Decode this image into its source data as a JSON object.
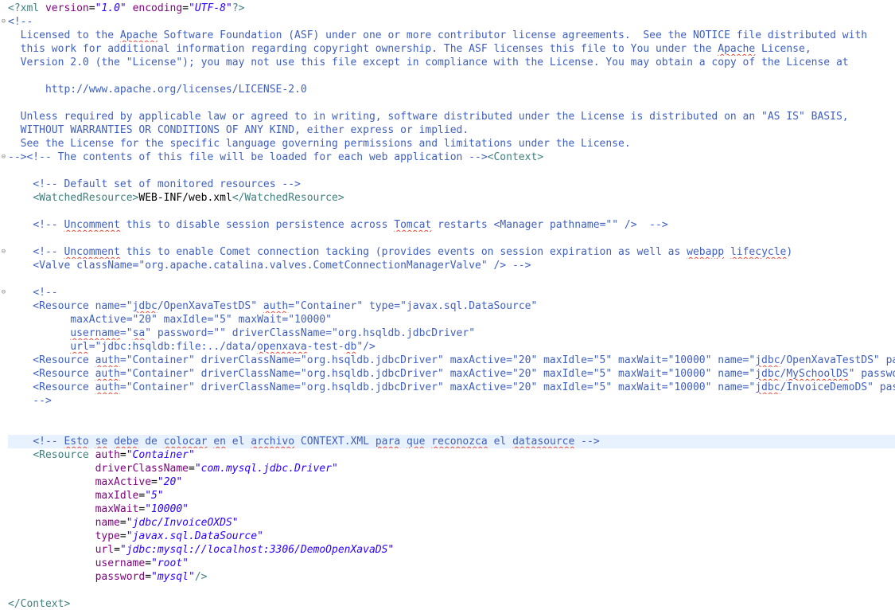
{
  "lines": [
    {
      "segs": [
        [
          "pi",
          "<?"
        ],
        [
          "tag",
          "xml "
        ],
        [
          "attr",
          "version"
        ],
        [
          "text",
          "="
        ],
        [
          "str",
          "\"1.0\""
        ],
        [
          "text",
          " "
        ],
        [
          "attr",
          "encoding"
        ],
        [
          "text",
          "="
        ],
        [
          "str",
          "\"UTF-8\""
        ],
        [
          "pi",
          "?>"
        ]
      ]
    },
    {
      "fold": true,
      "segs": [
        [
          "comment",
          "<!--"
        ]
      ]
    },
    {
      "segs": [
        [
          "comment",
          "  Licensed to the "
        ],
        [
          "comment",
          "Apache",
          "sq"
        ],
        [
          "comment",
          " Software Foundation (ASF) under one or more contributor license agreements.  See the NOTICE file distributed with"
        ]
      ]
    },
    {
      "segs": [
        [
          "comment",
          "  this work for additional information regarding copyright ownership. The ASF licenses this file to You under the "
        ],
        [
          "comment",
          "Apache",
          "sq"
        ],
        [
          "comment",
          " License,"
        ]
      ]
    },
    {
      "segs": [
        [
          "comment",
          "  Version 2.0 (the \"License\"); you may not use this file except in compliance with the License. You may obtain a copy of the License at"
        ]
      ]
    },
    {
      "segs": [
        [
          "comment",
          ""
        ]
      ]
    },
    {
      "segs": [
        [
          "comment",
          "      http://www.apache.org/licenses/LICENSE-2.0"
        ]
      ]
    },
    {
      "segs": [
        [
          "comment",
          ""
        ]
      ]
    },
    {
      "segs": [
        [
          "comment",
          "  Unless required by applicable law or agreed to in writing, software distributed under the License is distributed on an \"AS IS\" BASIS,"
        ]
      ]
    },
    {
      "segs": [
        [
          "comment",
          "  WITHOUT WARRANTIES OR CONDITIONS OF ANY KIND, either express or implied."
        ]
      ]
    },
    {
      "segs": [
        [
          "comment",
          "  See the License for the specific language governing permissions and limitations under the License."
        ]
      ]
    },
    {
      "fold": true,
      "segs": [
        [
          "comment",
          "--><!-- The contents of this file will be loaded for each web application -->"
        ],
        [
          "tag",
          "<Context>"
        ]
      ]
    },
    {
      "segs": [
        [
          "text",
          ""
        ]
      ]
    },
    {
      "segs": [
        [
          "text",
          "    "
        ],
        [
          "comment",
          "<!-- Default set of monitored resources -->"
        ]
      ]
    },
    {
      "segs": [
        [
          "text",
          "    "
        ],
        [
          "tag",
          "<WatchedResource>"
        ],
        [
          "text",
          "WEB-INF/web.xml"
        ],
        [
          "tag",
          "</WatchedResource>"
        ]
      ]
    },
    {
      "segs": [
        [
          "text",
          ""
        ]
      ]
    },
    {
      "segs": [
        [
          "text",
          "    "
        ],
        [
          "comment",
          "<!-- "
        ],
        [
          "comment",
          "Uncomment",
          "sq"
        ],
        [
          "comment",
          " this to disable session persistence across "
        ],
        [
          "comment",
          "Tomcat",
          "sq"
        ],
        [
          "comment",
          " restarts <Manager pathname=\"\" />  -->"
        ]
      ]
    },
    {
      "segs": [
        [
          "text",
          ""
        ]
      ]
    },
    {
      "fold": true,
      "segs": [
        [
          "text",
          "    "
        ],
        [
          "comment",
          "<!-- "
        ],
        [
          "comment",
          "Uncomment",
          "sq"
        ],
        [
          "comment",
          " this to enable Comet connection tacking (provides events on session expiration as well as "
        ],
        [
          "comment",
          "webapp",
          "sq"
        ],
        [
          "comment",
          " "
        ],
        [
          "comment",
          "lifecycle",
          "sq"
        ],
        [
          "comment",
          ")"
        ]
      ]
    },
    {
      "segs": [
        [
          "comment",
          "    <Valve className=\"org.apache.catalina.valves.CometConnectionManagerValve\" /> -->"
        ]
      ]
    },
    {
      "segs": [
        [
          "text",
          ""
        ]
      ]
    },
    {
      "fold": true,
      "segs": [
        [
          "text",
          "    "
        ],
        [
          "comment",
          "<!--"
        ]
      ]
    },
    {
      "segs": [
        [
          "comment",
          "    <Resource name=\""
        ],
        [
          "comment",
          "jdbc",
          "sq"
        ],
        [
          "comment",
          "/OpenXavaTestDS\" "
        ],
        [
          "comment",
          "auth",
          "sq"
        ],
        [
          "comment",
          "=\"Container\" type=\"javax.sql.DataSource\""
        ]
      ]
    },
    {
      "segs": [
        [
          "comment",
          "          maxActive=\"20\" maxIdle=\"5\" maxWait=\"10000\""
        ]
      ]
    },
    {
      "segs": [
        [
          "comment",
          "          "
        ],
        [
          "comment",
          "username",
          "sq"
        ],
        [
          "comment",
          "=\""
        ],
        [
          "comment",
          "sa",
          "sq"
        ],
        [
          "comment",
          "\" password=\"\" driverClassName=\"org.hsqldb.jdbcDriver\""
        ]
      ]
    },
    {
      "segs": [
        [
          "comment",
          "          "
        ],
        [
          "comment",
          "url",
          "sq"
        ],
        [
          "comment",
          "=\"jdbc:hsqldb:file:../data/"
        ],
        [
          "comment",
          "openxava",
          "sq"
        ],
        [
          "comment",
          "-test-"
        ],
        [
          "comment",
          "db",
          "sq"
        ],
        [
          "comment",
          "\"/>"
        ]
      ]
    },
    {
      "segs": [
        [
          "comment",
          "    <Resource "
        ],
        [
          "comment",
          "auth",
          "sq"
        ],
        [
          "comment",
          "=\"Container\" driverClassName=\"org.hsqldb.jdbcDriver\" maxActive=\"20\" maxIdle=\"5\" maxWait=\"10000\" name=\""
        ],
        [
          "comment",
          "jdbc",
          "sq"
        ],
        [
          "comment",
          "/OpenXavaTestDS\" password=\"\" type=\"javax.sql.DataSource\""
        ]
      ]
    },
    {
      "segs": [
        [
          "comment",
          "    <Resource "
        ],
        [
          "comment",
          "auth",
          "sq"
        ],
        [
          "comment",
          "=\"Container\" driverClassName=\"org.hsqldb.jdbcDriver\" maxActive=\"20\" maxIdle=\"5\" maxWait=\"10000\" name=\""
        ],
        [
          "comment",
          "jdbc",
          "sq"
        ],
        [
          "comment",
          "/"
        ],
        [
          "comment",
          "MySchoolDS",
          "sq"
        ],
        [
          "comment",
          "\" password=\"\" type=\"javax.sql.DataSource\""
        ]
      ]
    },
    {
      "segs": [
        [
          "comment",
          "    <Resource "
        ],
        [
          "comment",
          "auth",
          "sq"
        ],
        [
          "comment",
          "=\"Container\" driverClassName=\"org.hsqldb.jdbcDriver\" maxActive=\"20\" maxIdle=\"5\" maxWait=\"10000\" name=\""
        ],
        [
          "comment",
          "jdbc",
          "sq"
        ],
        [
          "comment",
          "/InvoiceDemoDS\" password=\"\" type=\"javax.sql.DataSource\""
        ]
      ]
    },
    {
      "segs": [
        [
          "comment",
          "    -->"
        ]
      ]
    },
    {
      "segs": [
        [
          "text",
          ""
        ]
      ]
    },
    {
      "segs": [
        [
          "text",
          ""
        ]
      ]
    },
    {
      "current": true,
      "segs": [
        [
          "text",
          "    "
        ],
        [
          "comment",
          "<!-- "
        ],
        [
          "comment",
          "Esto",
          "sq"
        ],
        [
          "comment",
          " "
        ],
        [
          "comment",
          "se",
          "sq"
        ],
        [
          "comment",
          " "
        ],
        [
          "comment",
          "debe",
          "sq"
        ],
        [
          "comment",
          " de "
        ],
        [
          "comment",
          "colocar",
          "sq"
        ],
        [
          "comment",
          " "
        ],
        [
          "comment",
          "en",
          "sq"
        ],
        [
          "comment",
          " el "
        ],
        [
          "comment",
          "archivo",
          "sq"
        ],
        [
          "comment",
          " CONTEXT.XML "
        ],
        [
          "comment",
          "para",
          "sq"
        ],
        [
          "comment",
          " "
        ],
        [
          "comment",
          "que",
          "sq"
        ],
        [
          "comment",
          " "
        ],
        [
          "comment",
          "reconozca",
          "sq"
        ],
        [
          "comment",
          " el "
        ],
        [
          "comment",
          "datasource",
          "sq"
        ],
        [
          "comment",
          " -->"
        ]
      ]
    },
    {
      "segs": [
        [
          "text",
          "    "
        ],
        [
          "tag",
          "<Resource "
        ],
        [
          "attr",
          "auth"
        ],
        [
          "text",
          "="
        ],
        [
          "str",
          "\"Container\""
        ]
      ]
    },
    {
      "segs": [
        [
          "text",
          "              "
        ],
        [
          "attr",
          "driverClassName"
        ],
        [
          "text",
          "="
        ],
        [
          "str",
          "\"com.mysql.jdbc.Driver\""
        ]
      ]
    },
    {
      "segs": [
        [
          "text",
          "              "
        ],
        [
          "attr",
          "maxActive"
        ],
        [
          "text",
          "="
        ],
        [
          "str",
          "\"20\""
        ]
      ]
    },
    {
      "segs": [
        [
          "text",
          "              "
        ],
        [
          "attr",
          "maxIdle"
        ],
        [
          "text",
          "="
        ],
        [
          "str",
          "\"5\""
        ]
      ]
    },
    {
      "segs": [
        [
          "text",
          "              "
        ],
        [
          "attr",
          "maxWait"
        ],
        [
          "text",
          "="
        ],
        [
          "str",
          "\"10000\""
        ]
      ]
    },
    {
      "segs": [
        [
          "text",
          "              "
        ],
        [
          "attr",
          "name"
        ],
        [
          "text",
          "="
        ],
        [
          "str",
          "\"jdbc/InvoiceOXDS\""
        ]
      ]
    },
    {
      "segs": [
        [
          "text",
          "              "
        ],
        [
          "attr",
          "type"
        ],
        [
          "text",
          "="
        ],
        [
          "str",
          "\"javax.sql.DataSource\""
        ]
      ]
    },
    {
      "segs": [
        [
          "text",
          "              "
        ],
        [
          "attr",
          "url"
        ],
        [
          "text",
          "="
        ],
        [
          "str",
          "\"jdbc:mysql://localhost:3306/DemoOpenXavaDS\""
        ]
      ]
    },
    {
      "segs": [
        [
          "text",
          "              "
        ],
        [
          "attr",
          "username"
        ],
        [
          "text",
          "="
        ],
        [
          "str",
          "\"root\""
        ]
      ]
    },
    {
      "segs": [
        [
          "text",
          "              "
        ],
        [
          "attr",
          "password"
        ],
        [
          "text",
          "="
        ],
        [
          "str",
          "\"mysql\""
        ],
        [
          "tag",
          "/>"
        ]
      ]
    },
    {
      "segs": [
        [
          "text",
          ""
        ]
      ]
    },
    {
      "segs": [
        [
          "tag",
          "</Context>"
        ]
      ]
    }
  ]
}
